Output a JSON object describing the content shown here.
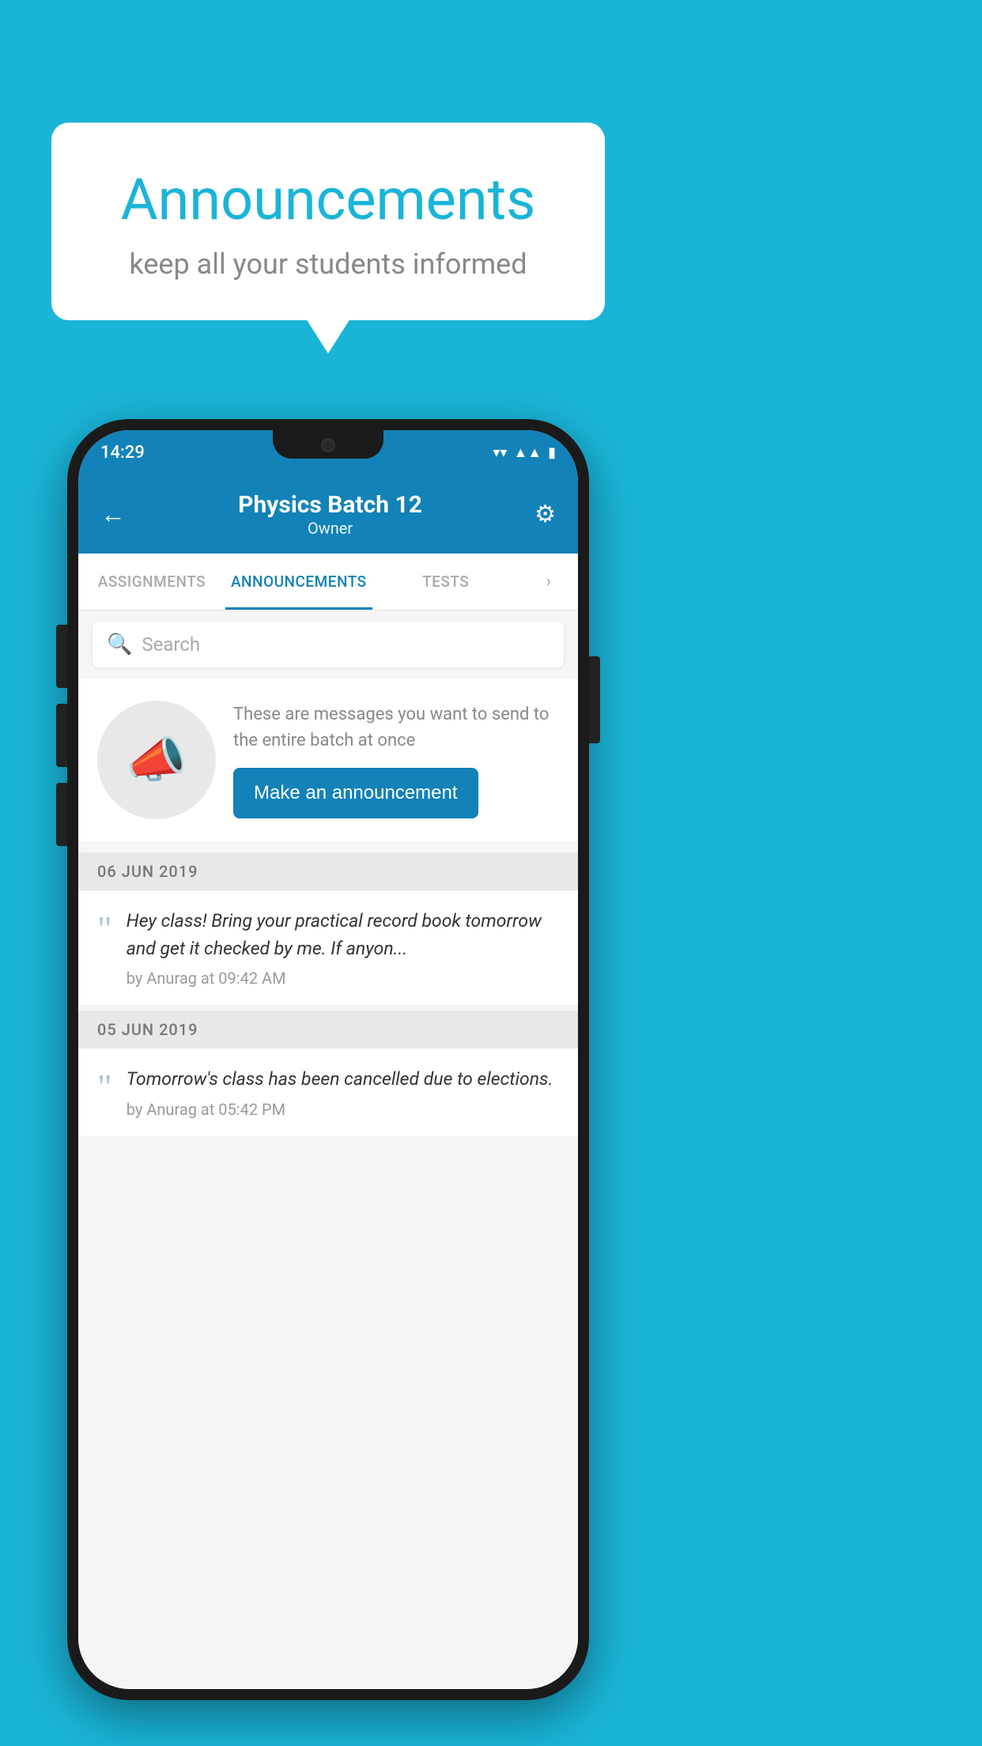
{
  "background_color": "#1ab4d7",
  "speech_bubble": {
    "title": "Announcements",
    "subtitle": "keep all your students informed"
  },
  "phone": {
    "status_bar": {
      "time": "14:29",
      "wifi_icon": "wifi",
      "signal_icon": "signal",
      "battery_icon": "battery"
    },
    "app_bar": {
      "back_label": "←",
      "title": "Physics Batch 12",
      "subtitle": "Owner",
      "settings_icon": "gear"
    },
    "tabs": [
      {
        "label": "ASSIGNMENTS",
        "active": false
      },
      {
        "label": "ANNOUNCEMENTS",
        "active": true
      },
      {
        "label": "TESTS",
        "active": false
      }
    ],
    "search": {
      "placeholder": "Search"
    },
    "announcement_prompt": {
      "description": "These are messages you want to send to the entire batch at once",
      "button_label": "Make an announcement"
    },
    "announcements": [
      {
        "date": "06  JUN  2019",
        "text": "Hey class! Bring your practical record book tomorrow and get it checked by me. If anyon...",
        "meta": "by Anurag at 09:42 AM"
      },
      {
        "date": "05  JUN  2019",
        "text": "Tomorrow's class has been cancelled due to elections.",
        "meta": "by Anurag at 05:42 PM"
      }
    ]
  }
}
